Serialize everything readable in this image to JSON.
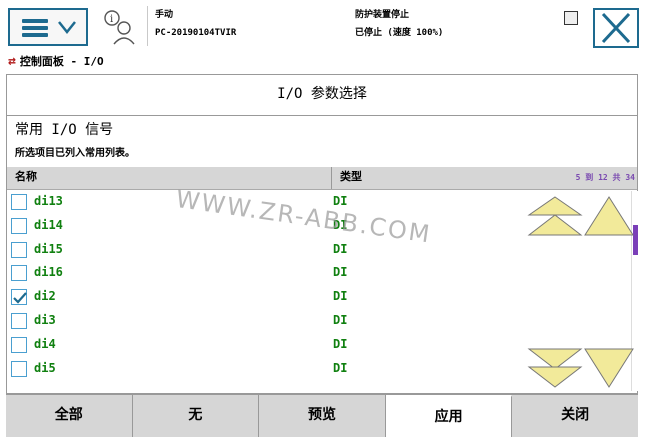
{
  "status": {
    "mode": "手动",
    "controller": "PC-20190104TVIR",
    "safety": "防护装置停止",
    "state": "已停止 (速度 100%)"
  },
  "breadcrumb": "控制面板 - I/O",
  "panel_title": "I/O 参数选择",
  "section": {
    "title": "常用 I/O 信号",
    "subtitle": "所选项目已列入常用列表。"
  },
  "table": {
    "col_name": "名称",
    "col_type": "类型",
    "range": "5 到 12 共 34",
    "rows": [
      {
        "name": "di13",
        "type": "DI",
        "checked": false
      },
      {
        "name": "di14",
        "type": "DI",
        "checked": false
      },
      {
        "name": "di15",
        "type": "DI",
        "checked": false
      },
      {
        "name": "di16",
        "type": "DI",
        "checked": false
      },
      {
        "name": "di2",
        "type": "DI",
        "checked": true
      },
      {
        "name": "di3",
        "type": "DI",
        "checked": false
      },
      {
        "name": "di4",
        "type": "DI",
        "checked": false
      },
      {
        "name": "di5",
        "type": "DI",
        "checked": false
      }
    ]
  },
  "watermark": "WWW.ZR-ABB.COM",
  "buttons": {
    "all": "全部",
    "none": "无",
    "preview": "预览",
    "apply": "应用",
    "close": "关闭"
  },
  "colors": {
    "accent": "#1d6a8f",
    "signal_text": "#108010",
    "nav_arrow": "#f2ea9a",
    "scroll_thumb": "#7a3fb8"
  }
}
